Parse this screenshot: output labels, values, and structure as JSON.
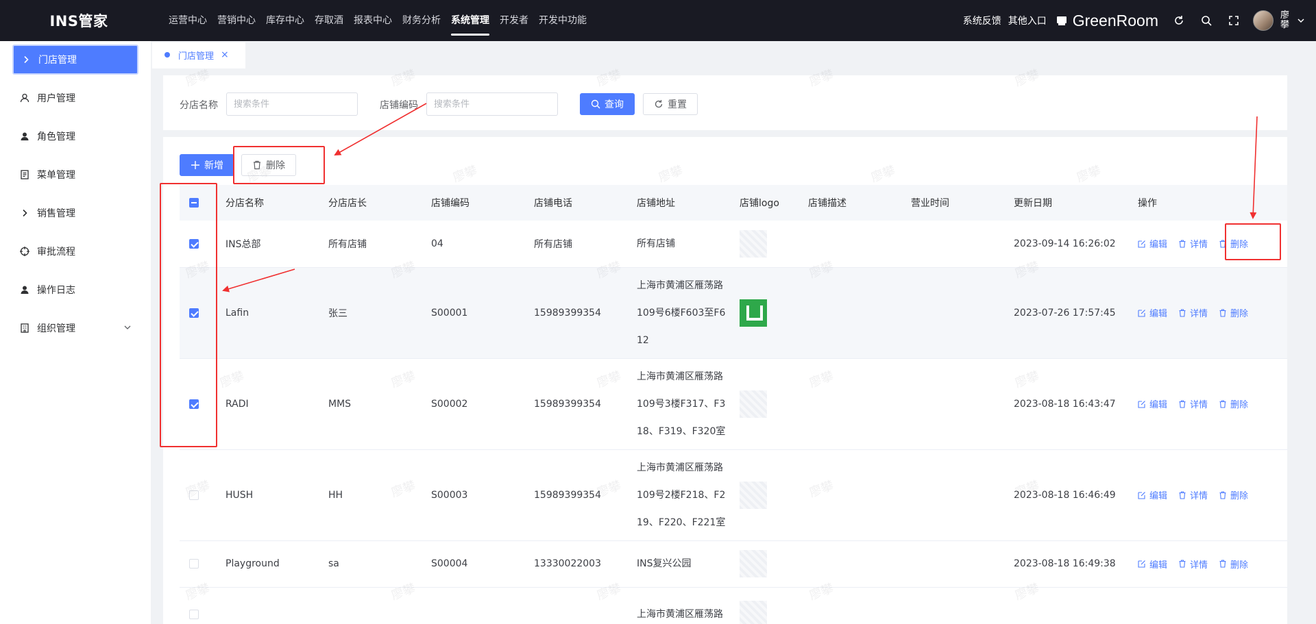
{
  "header": {
    "brand": "INS管家",
    "nav": [
      "运营中心",
      "营销中心",
      "库存中心",
      "存取酒",
      "报表中心",
      "财务分析",
      "系统管理",
      "开发者",
      "开发中功能"
    ],
    "active_nav": "系统管理",
    "feedback": "系统反馈",
    "other_entry": "其他入口",
    "store_name": "GreenRoom",
    "user_name": "廖攀"
  },
  "sidebar": {
    "items": [
      {
        "label": "门店管理",
        "icon": "chevron-right-icon",
        "active": true
      },
      {
        "label": "用户管理",
        "icon": "user-outline-icon"
      },
      {
        "label": "角色管理",
        "icon": "user-icon"
      },
      {
        "label": "菜单管理",
        "icon": "document-icon"
      },
      {
        "label": "销售管理",
        "icon": "chevron-right-icon"
      },
      {
        "label": "审批流程",
        "icon": "crosshair-icon"
      },
      {
        "label": "操作日志",
        "icon": "user-icon"
      },
      {
        "label": "组织管理",
        "icon": "building-icon",
        "expandable": true
      }
    ]
  },
  "tabs": {
    "active": {
      "label": "门店管理",
      "close": "×"
    }
  },
  "search": {
    "branch_label": "分店名称",
    "branch_placeholder": "搜索条件",
    "code_label": "店铺编码",
    "code_placeholder": "搜索条件",
    "query_label": "查询",
    "reset_label": "重置"
  },
  "toolbar": {
    "add_label": "新增",
    "delete_label": "删除"
  },
  "table": {
    "columns": [
      "分店名称",
      "分店店长",
      "店铺编码",
      "店铺电话",
      "店铺地址",
      "店铺logo",
      "店铺描述",
      "营业时间",
      "更新日期",
      "操作"
    ],
    "actions": {
      "edit": "编辑",
      "detail": "详情",
      "delete": "删除"
    },
    "rows": [
      {
        "name": "INS总部",
        "manager": "所有店铺",
        "code": "04",
        "phone": "所有店铺",
        "address": [
          "所有店铺"
        ],
        "logo": "placeholder",
        "updated": "2023-09-14 16:26:02",
        "checked": true
      },
      {
        "name": "Lafin",
        "manager": "张三",
        "code": "S00001",
        "phone": "15989399354",
        "address": [
          "上海市黄浦区雁荡路",
          "109号6楼F603至F6",
          "12"
        ],
        "logo": "green",
        "updated": "2023-07-26 17:57:45",
        "checked": true
      },
      {
        "name": "RADI",
        "manager": "MMS",
        "code": "S00002",
        "phone": "15989399354",
        "address": [
          "上海市黄浦区雁荡路",
          "109号3楼F317、F3",
          "18、F319、F320室"
        ],
        "logo": "placeholder",
        "updated": "2023-08-18 16:43:47",
        "checked": true
      },
      {
        "name": "HUSH",
        "manager": "HH",
        "code": "S00003",
        "phone": "15989399354",
        "address": [
          "上海市黄浦区雁荡路",
          "109号2楼F218、F2",
          "19、F220、F221室"
        ],
        "logo": "placeholder",
        "updated": "2023-08-18 16:46:49",
        "checked": false
      },
      {
        "name": "Playground",
        "manager": "sa",
        "code": "S00004",
        "phone": "13330022003",
        "address": [
          "INS复兴公园"
        ],
        "logo": "placeholder",
        "updated": "2023-08-18 16:49:38",
        "checked": false
      },
      {
        "name": "",
        "manager": "",
        "code": "",
        "phone": "",
        "address": [
          "上海市黄浦区雁荡路"
        ],
        "logo": "placeholder",
        "updated": "",
        "checked": false
      }
    ]
  },
  "watermark": "廖攀",
  "colors": {
    "topbar": "#191a23",
    "primary": "#4e7cff",
    "annotation": "#f03030"
  }
}
